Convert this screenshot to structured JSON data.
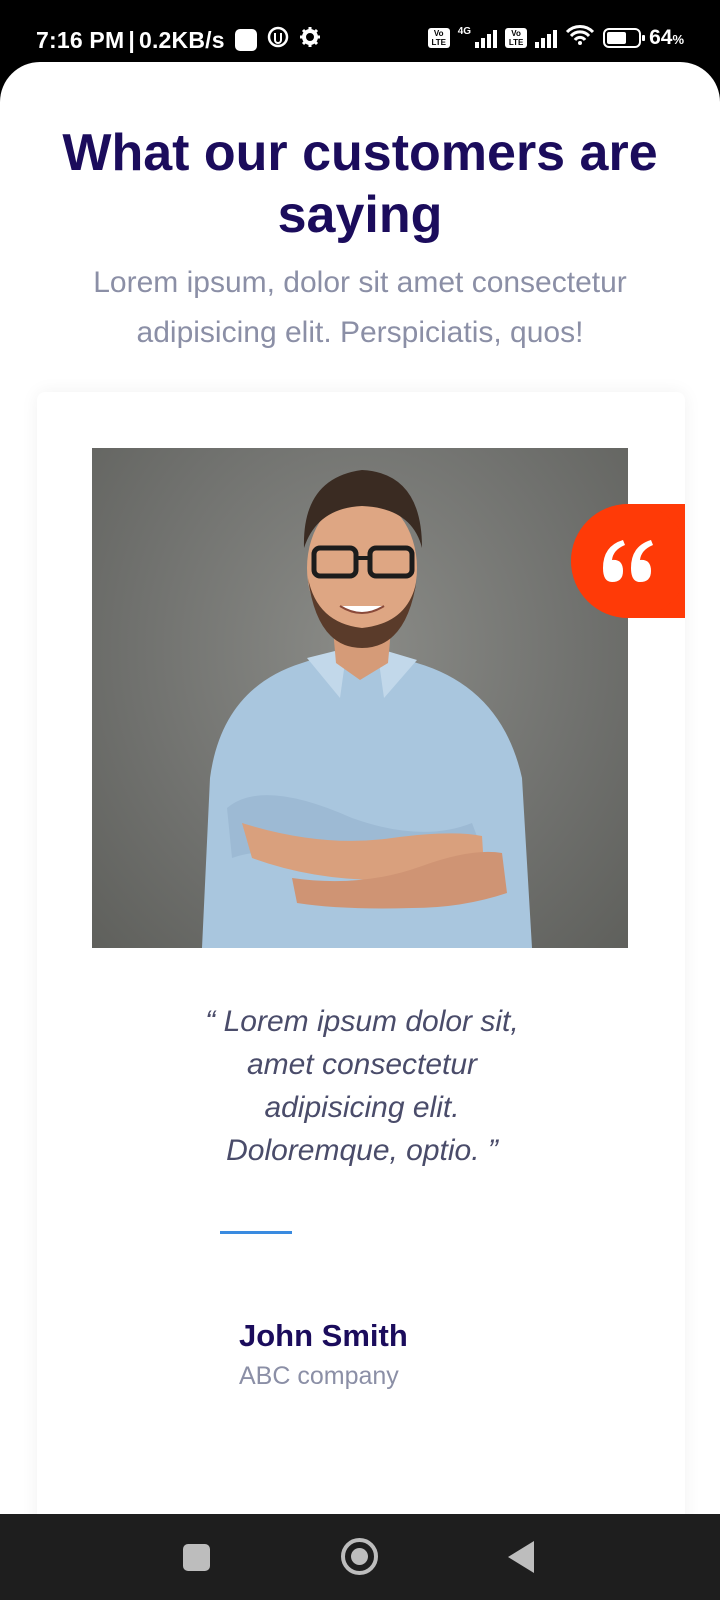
{
  "status_bar": {
    "time": "7:16 PM",
    "separator": "|",
    "speed": "0.2KB/s",
    "network_type": "4G",
    "volte_label": "Vo LTE",
    "battery_percent": "64",
    "battery_unit": "%",
    "battery_level": 0.64
  },
  "header": {
    "title": "What our customers are saying",
    "subtitle": "Lorem ipsum, dolor sit amet consectetur adipisicing elit. Perspiciatis, quos!"
  },
  "testimonial": {
    "quote": "“ Lorem ipsum dolor sit, amet consectetur adipisicing elit. Doloremque, optio. ”",
    "name": "John Smith",
    "company": "ABC company",
    "quote_icon": "quote-icon",
    "accent_color": "#ff3a07",
    "divider_color": "#3a8be0"
  },
  "nav_bar": {
    "recents_icon": "recents-icon",
    "home_icon": "home-icon",
    "back_icon": "back-icon"
  },
  "colors": {
    "title": "#1b0c5c",
    "subtitle": "#8b8fa6",
    "quote_text": "#4a4c6a"
  }
}
